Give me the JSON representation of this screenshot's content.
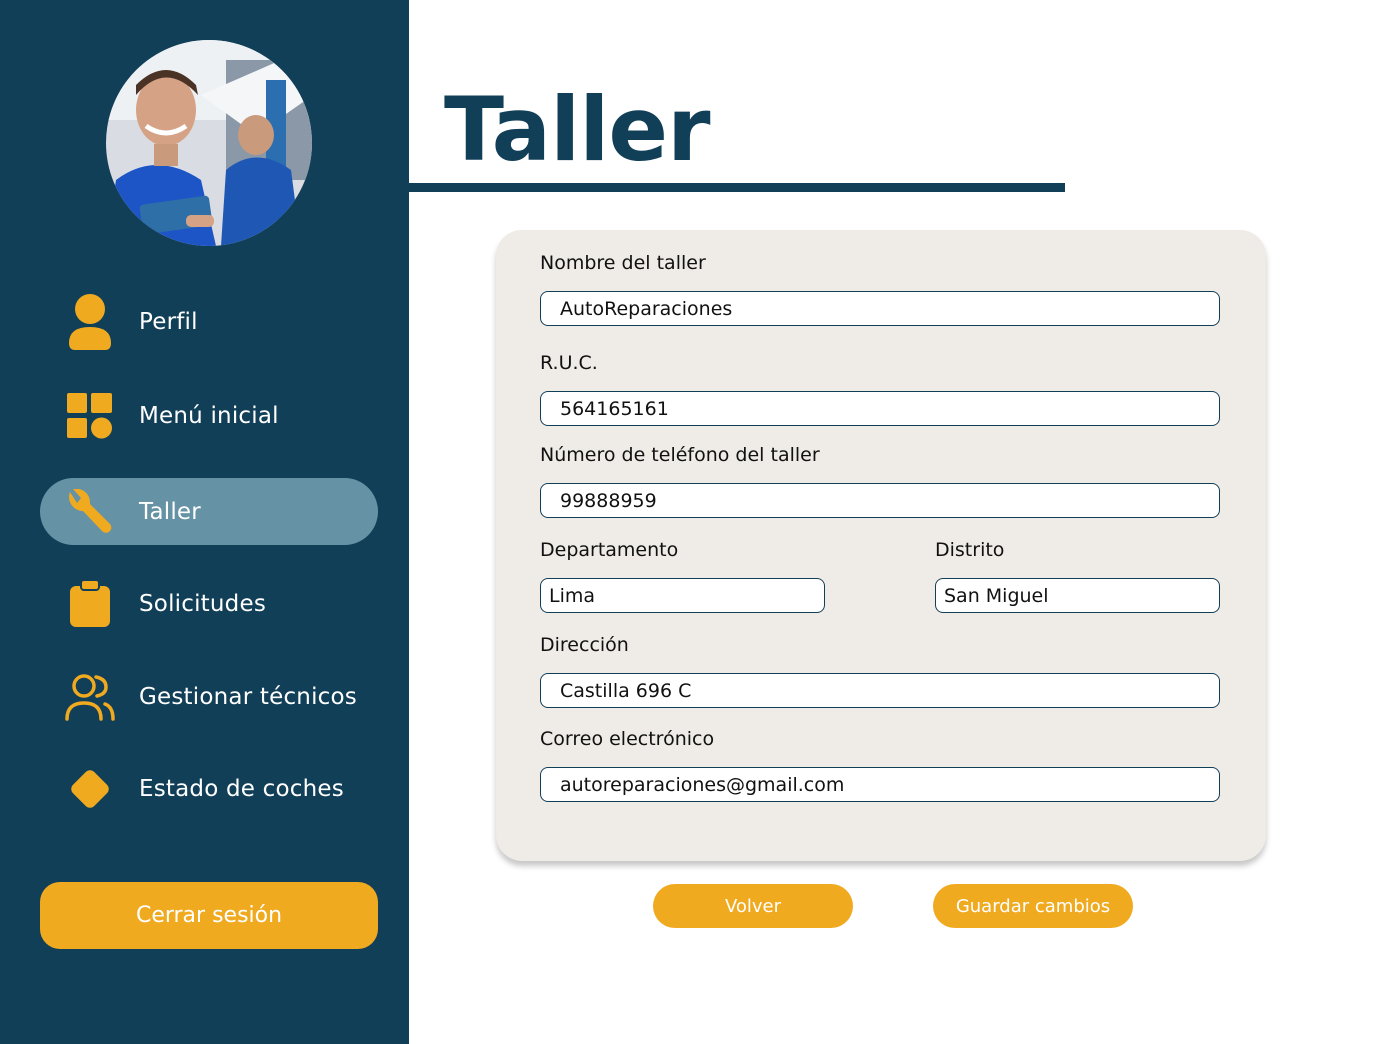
{
  "colors": {
    "sidebar_bg": "#123f58",
    "accent": "#f0aa20",
    "active_item": "#6592a4",
    "card_bg": "#efebe6",
    "title": "#123f58"
  },
  "sidebar": {
    "items": [
      {
        "label": "Perfil",
        "icon": "user-icon",
        "active": false
      },
      {
        "label": "Menú inicial",
        "icon": "dashboard-grid-icon",
        "active": false
      },
      {
        "label": "Taller",
        "icon": "wrench-icon",
        "active": true
      },
      {
        "label": "Solicitudes",
        "icon": "clipboard-icon",
        "active": false
      },
      {
        "label": "Gestionar técnicos",
        "icon": "users-icon",
        "active": false
      },
      {
        "label": "Estado de coches",
        "icon": "diamond-icon",
        "active": false
      }
    ],
    "logout_label": "Cerrar sesión"
  },
  "main": {
    "title": "Taller",
    "form": {
      "nombre": {
        "label": "Nombre del taller",
        "value": "AutoReparaciones"
      },
      "ruc": {
        "label": "R.U.C.",
        "value": "564165161"
      },
      "telefono": {
        "label": "Número de teléfono del taller",
        "value": "99888959"
      },
      "departamento": {
        "label": "Departamento",
        "value": "Lima"
      },
      "distrito": {
        "label": "Distrito",
        "value": "San Miguel"
      },
      "direccion": {
        "label": "Dirección",
        "value": "Castilla 696 C"
      },
      "correo": {
        "label": "Correo electrónico",
        "value": "autoreparaciones@gmail.com"
      }
    },
    "buttons": {
      "back": "Volver",
      "save": "Guardar cambios"
    }
  }
}
